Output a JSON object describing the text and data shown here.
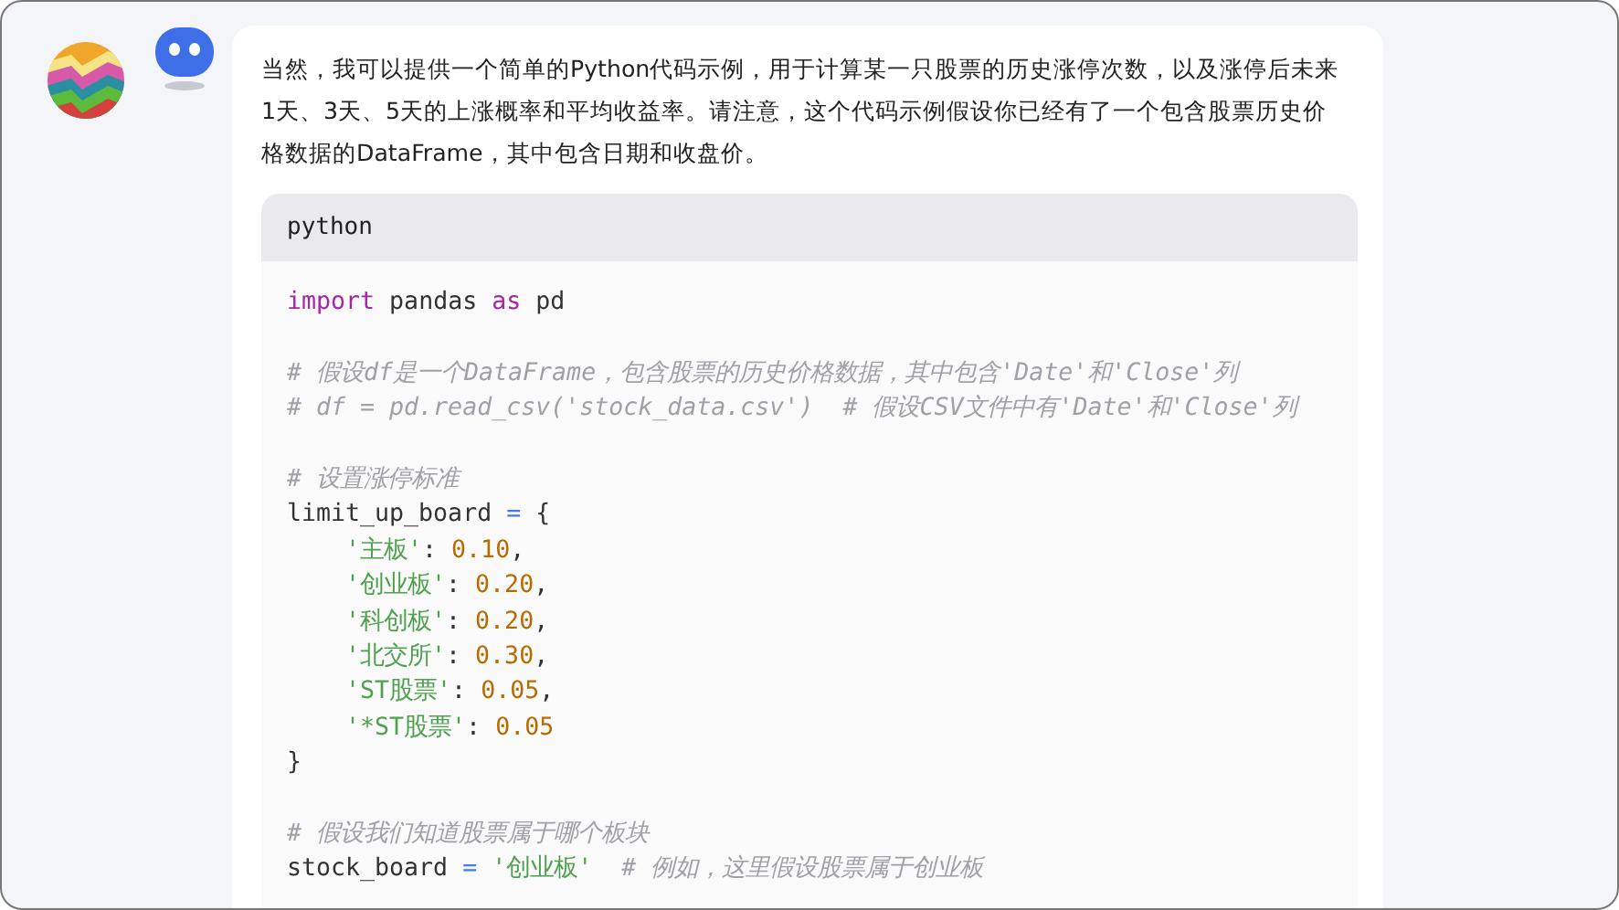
{
  "message": {
    "paragraph": "当然，我可以提供一个简单的Python代码示例，用于计算某一只股票的历史涨停次数，以及涨停后未来1天、3天、5天的上涨概率和平均收益率。请注意，这个代码示例假设你已经有了一个包含股票历史价格数据的DataFrame，其中包含日期和收盘价。",
    "code": {
      "language": "python",
      "blocks": [
        [
          {
            "tokens": [
              {
                "kind": "keyword",
                "text": "import"
              },
              {
                "kind": "plain",
                "text": " pandas "
              },
              {
                "kind": "keyword",
                "text": "as"
              },
              {
                "kind": "plain",
                "text": " pd"
              }
            ]
          }
        ],
        [
          {
            "tokens": [
              {
                "kind": "comment",
                "text": "# 假设df是一个DataFrame，包含股票的历史价格数据，其中包含'Date'和'Close'列"
              }
            ]
          },
          {
            "tokens": [
              {
                "kind": "comment",
                "text": "# df = pd.read_csv('stock_data.csv')  # 假设CSV文件中有'Date'和'Close'列"
              }
            ]
          }
        ],
        [
          {
            "tokens": [
              {
                "kind": "comment",
                "text": "# 设置涨停标准"
              }
            ]
          },
          {
            "tokens": [
              {
                "kind": "plain",
                "text": "limit_up_board "
              },
              {
                "kind": "operator",
                "text": "="
              },
              {
                "kind": "plain",
                "text": " {"
              }
            ],
            "children": [
              {
                "tokens": [
                  {
                    "kind": "string",
                    "text": "'主板'"
                  },
                  {
                    "kind": "plain",
                    "text": ": "
                  },
                  {
                    "kind": "number",
                    "text": "0.10"
                  },
                  {
                    "kind": "plain",
                    "text": ","
                  }
                ]
              },
              {
                "tokens": [
                  {
                    "kind": "string",
                    "text": "'创业板'"
                  },
                  {
                    "kind": "plain",
                    "text": ": "
                  },
                  {
                    "kind": "number",
                    "text": "0.20"
                  },
                  {
                    "kind": "plain",
                    "text": ","
                  }
                ]
              },
              {
                "tokens": [
                  {
                    "kind": "string",
                    "text": "'科创板'"
                  },
                  {
                    "kind": "plain",
                    "text": ": "
                  },
                  {
                    "kind": "number",
                    "text": "0.20"
                  },
                  {
                    "kind": "plain",
                    "text": ","
                  }
                ]
              },
              {
                "tokens": [
                  {
                    "kind": "string",
                    "text": "'北交所'"
                  },
                  {
                    "kind": "plain",
                    "text": ": "
                  },
                  {
                    "kind": "number",
                    "text": "0.30"
                  },
                  {
                    "kind": "plain",
                    "text": ","
                  }
                ]
              },
              {
                "tokens": [
                  {
                    "kind": "string",
                    "text": "'ST股票'"
                  },
                  {
                    "kind": "plain",
                    "text": ": "
                  },
                  {
                    "kind": "number",
                    "text": "0.05"
                  },
                  {
                    "kind": "plain",
                    "text": ","
                  }
                ]
              },
              {
                "tokens": [
                  {
                    "kind": "string",
                    "text": "'*ST股票'"
                  },
                  {
                    "kind": "plain",
                    "text": ": "
                  },
                  {
                    "kind": "number",
                    "text": "0.05"
                  }
                ]
              }
            ]
          },
          {
            "tokens": [
              {
                "kind": "plain",
                "text": "}"
              }
            ]
          }
        ],
        [
          {
            "tokens": [
              {
                "kind": "comment",
                "text": "# 假设我们知道股票属于哪个板块"
              }
            ]
          },
          {
            "tokens": [
              {
                "kind": "plain",
                "text": "stock_board "
              },
              {
                "kind": "operator",
                "text": "="
              },
              {
                "kind": "string",
                "text": " '创业板'"
              },
              {
                "kind": "comment",
                "text": "  # 例如，这里假设股票属于创业板"
              }
            ]
          }
        ]
      ]
    }
  }
}
